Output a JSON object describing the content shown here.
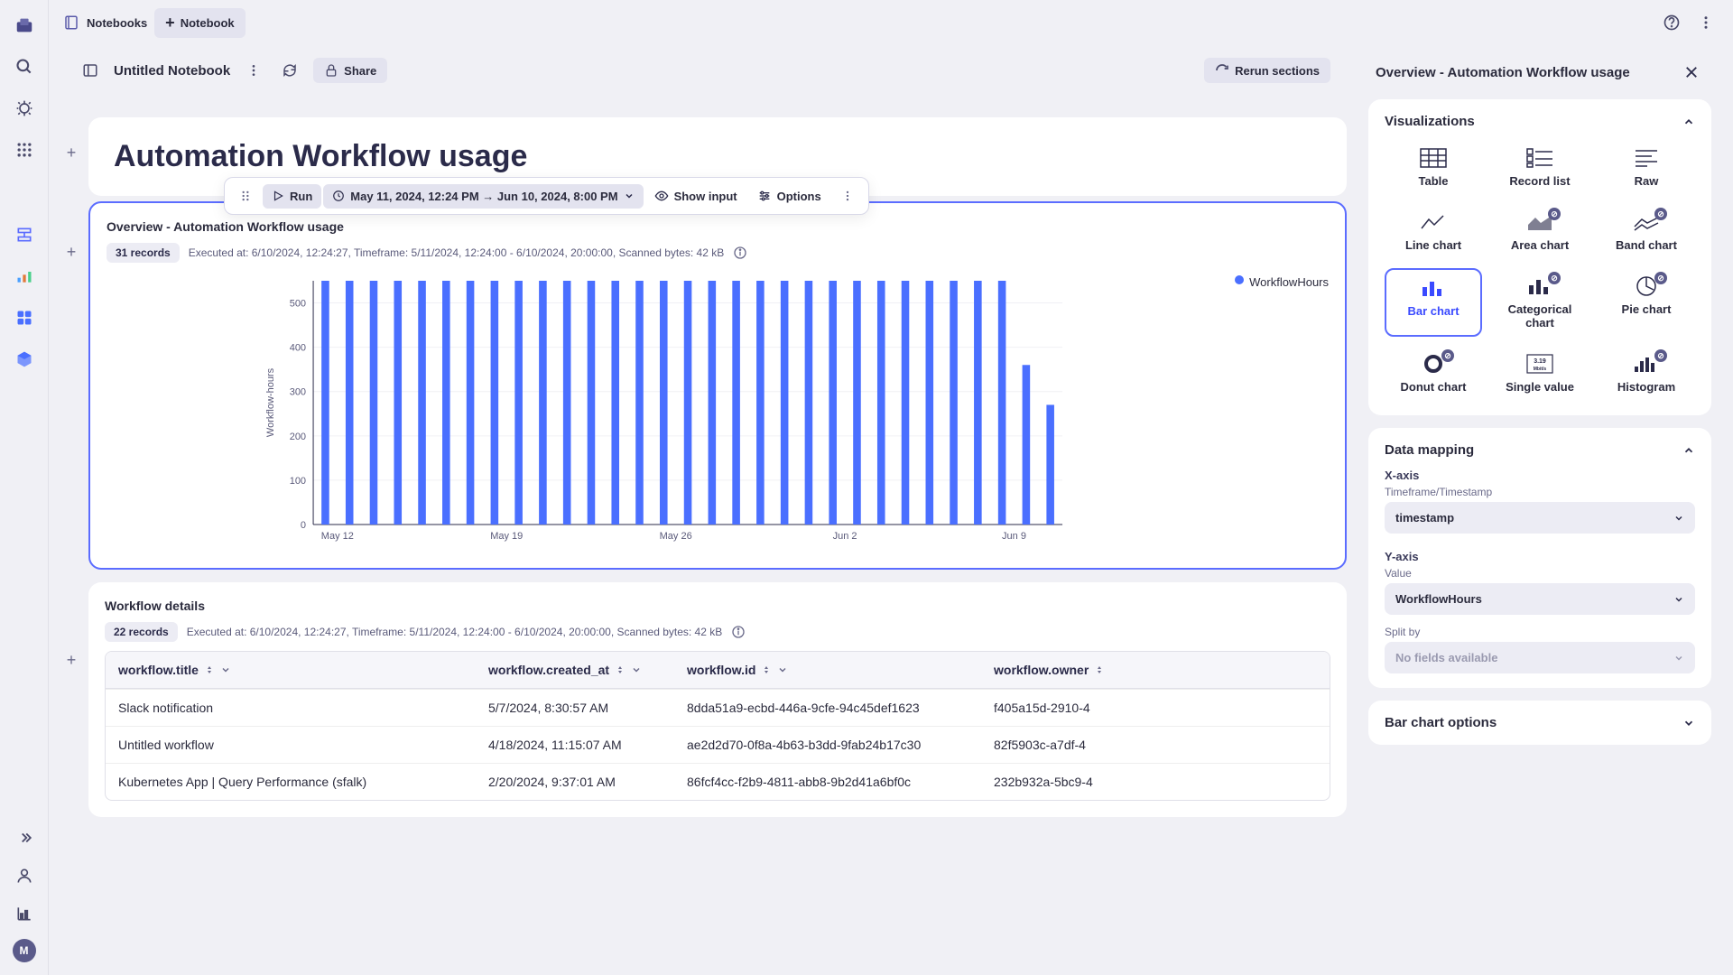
{
  "rail": {
    "avatar": "M"
  },
  "topbar": {
    "notebooks": "Notebooks",
    "new_notebook": "Notebook"
  },
  "header": {
    "nb_title": "Untitled Notebook",
    "share": "Share",
    "rerun": "Rerun sections"
  },
  "doc": {
    "title": "Automation Workflow usage"
  },
  "toolbar": {
    "run": "Run",
    "timerange": "May 11, 2024, 12:24 PM → Jun 10, 2024, 8:00 PM",
    "show_input": "Show input",
    "options": "Options"
  },
  "section_overview": {
    "title": "Overview - Automation Workflow usage",
    "records": "31 records",
    "meta": "Executed at: 6/10/2024, 12:24:27, Timeframe: 5/11/2024, 12:24:00 - 6/10/2024, 20:00:00, Scanned bytes: 42 kB",
    "legend": "WorkflowHours",
    "yaxis": "Workflow-hours"
  },
  "chart_data": {
    "type": "bar",
    "ylabel": "Workflow-hours",
    "ylim": [
      0,
      550
    ],
    "yticks": [
      0,
      100,
      200,
      300,
      400,
      500
    ],
    "xticks": [
      "May 12",
      "May 19",
      "May 26",
      "Jun 2",
      "Jun 9"
    ],
    "series": "WorkflowHours",
    "values": [
      550,
      550,
      550,
      550,
      550,
      550,
      550,
      550,
      550,
      550,
      550,
      550,
      550,
      550,
      550,
      550,
      550,
      550,
      550,
      550,
      550,
      550,
      550,
      550,
      550,
      550,
      550,
      550,
      550,
      360,
      270
    ]
  },
  "section_details": {
    "title": "Workflow details",
    "records": "22 records",
    "meta": "Executed at: 6/10/2024, 12:24:27, Timeframe: 5/11/2024, 12:24:00 - 6/10/2024, 20:00:00, Scanned bytes: 42 kB",
    "columns": [
      "workflow.title",
      "workflow.created_at",
      "workflow.id",
      "workflow.owner"
    ],
    "rows": [
      [
        "Slack notification",
        "5/7/2024, 8:30:57 AM",
        "8dda51a9-ecbd-446a-9cfe-94c45def1623",
        "f405a15d-2910-4"
      ],
      [
        "Untitled workflow",
        "4/18/2024, 11:15:07 AM",
        "ae2d2d70-0f8a-4b63-b3dd-9fab24b17c30",
        "82f5903c-a7df-4"
      ],
      [
        "Kubernetes App | Query Performance (sfalk)",
        "2/20/2024, 9:37:01 AM",
        "86fcf4cc-f2b9-4811-abb8-9b2d41a6bf0c",
        "232b932a-5bc9-4"
      ]
    ]
  },
  "side": {
    "title": "Overview - Automation Workflow usage",
    "viz_title": "Visualizations",
    "viz": {
      "table": "Table",
      "record": "Record list",
      "raw": "Raw",
      "line": "Line chart",
      "area": "Area chart",
      "band": "Band chart",
      "bar": "Bar chart",
      "cat": "Categorical chart",
      "pie": "Pie chart",
      "donut": "Donut chart",
      "single": "Single value",
      "hist": "Histogram"
    },
    "mapping": {
      "title": "Data mapping",
      "xaxis": "X-axis",
      "xaxis_sub": "Timeframe/Timestamp",
      "xaxis_val": "timestamp",
      "yaxis": "Y-axis",
      "yaxis_sub": "Value",
      "yaxis_val": "WorkflowHours",
      "split": "Split by",
      "split_val": "No fields available"
    },
    "options": "Bar chart options"
  }
}
